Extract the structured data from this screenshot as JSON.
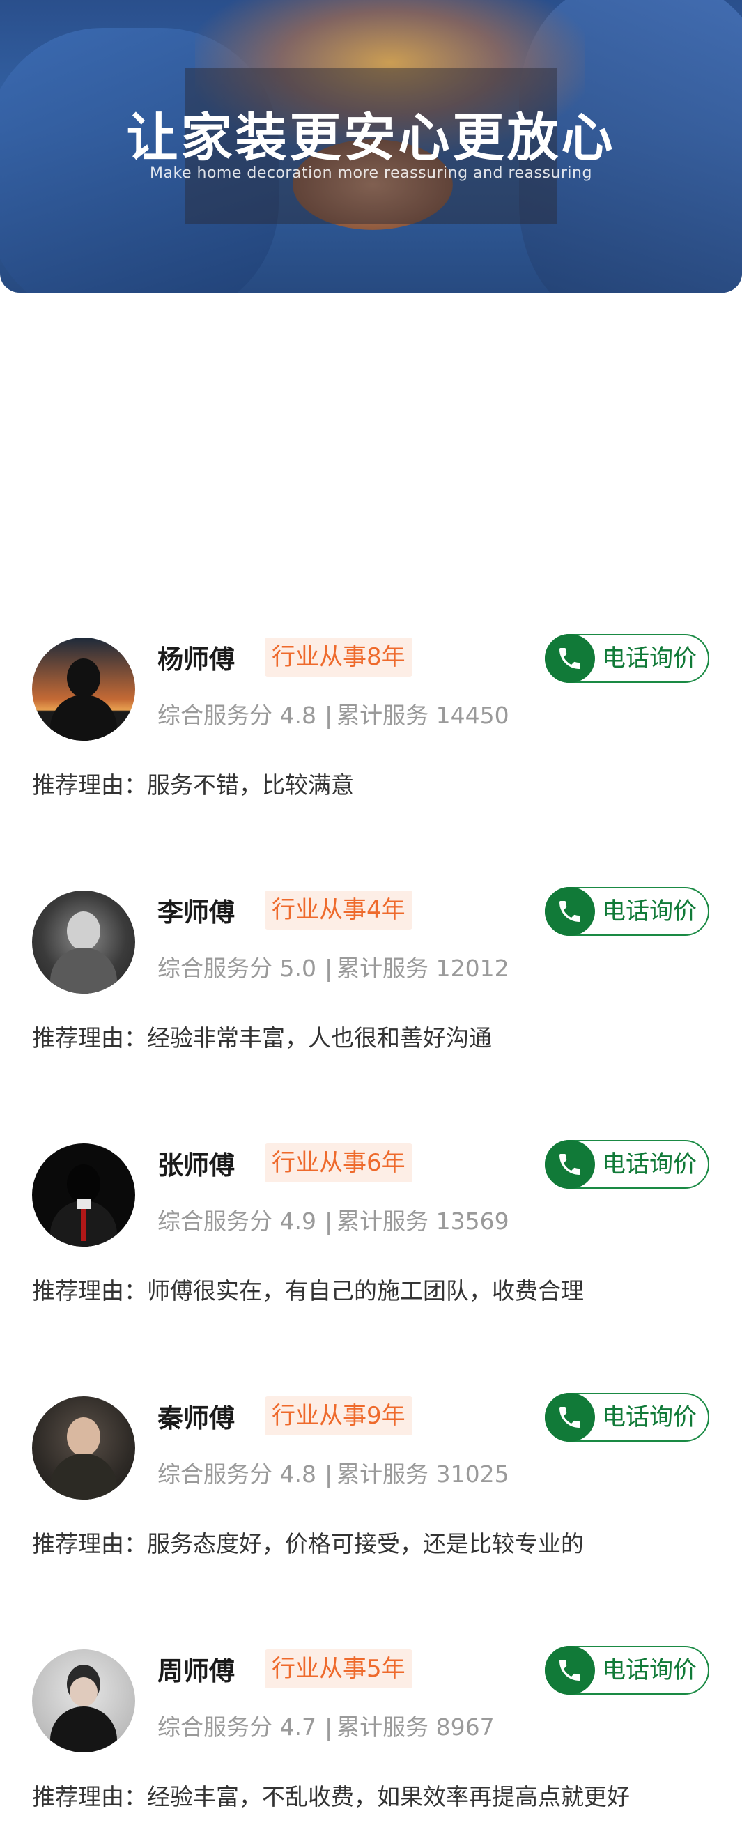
{
  "banner": {
    "title": "让家装更安心更放心",
    "subtitle": "Make home decoration more reassuring and reassuring"
  },
  "labels": {
    "score_prefix": "综合服务分",
    "count_prefix": "累计服务",
    "separator": "|",
    "reason_prefix": "推荐理由：",
    "call_button": "电话询价"
  },
  "colors": {
    "accent_green": "#117a38",
    "badge_orange": "#ee6a2c",
    "badge_bg": "#fdeee6"
  },
  "workers": [
    {
      "name": "杨师傅",
      "experience": "行业从事8年",
      "score": "4.8",
      "count": "14450",
      "reason": "服务不错，比较满意",
      "avatar_icon": "silhouette-sunset-avatar"
    },
    {
      "name": "李师傅",
      "experience": "行业从事4年",
      "score": "5.0",
      "count": "12012",
      "reason": "经验非常丰富，人也很和善好沟通",
      "avatar_icon": "bw-portrait-avatar"
    },
    {
      "name": "张师傅",
      "experience": "行业从事6年",
      "score": "4.9",
      "count": "13569",
      "reason": "师傅很实在，有自己的施工团队，收费合理",
      "avatar_icon": "suit-red-tie-avatar"
    },
    {
      "name": "秦师傅",
      "experience": "行业从事9年",
      "score": "4.8",
      "count": "31025",
      "reason": "服务态度好，价格可接受，还是比较专业的",
      "avatar_icon": "young-man-avatar"
    },
    {
      "name": "周师傅",
      "experience": "行业从事5年",
      "score": "4.7",
      "count": "8967",
      "reason": "经验丰富，不乱收费，如果效率再提高点就更好",
      "avatar_icon": "black-suit-avatar"
    }
  ]
}
